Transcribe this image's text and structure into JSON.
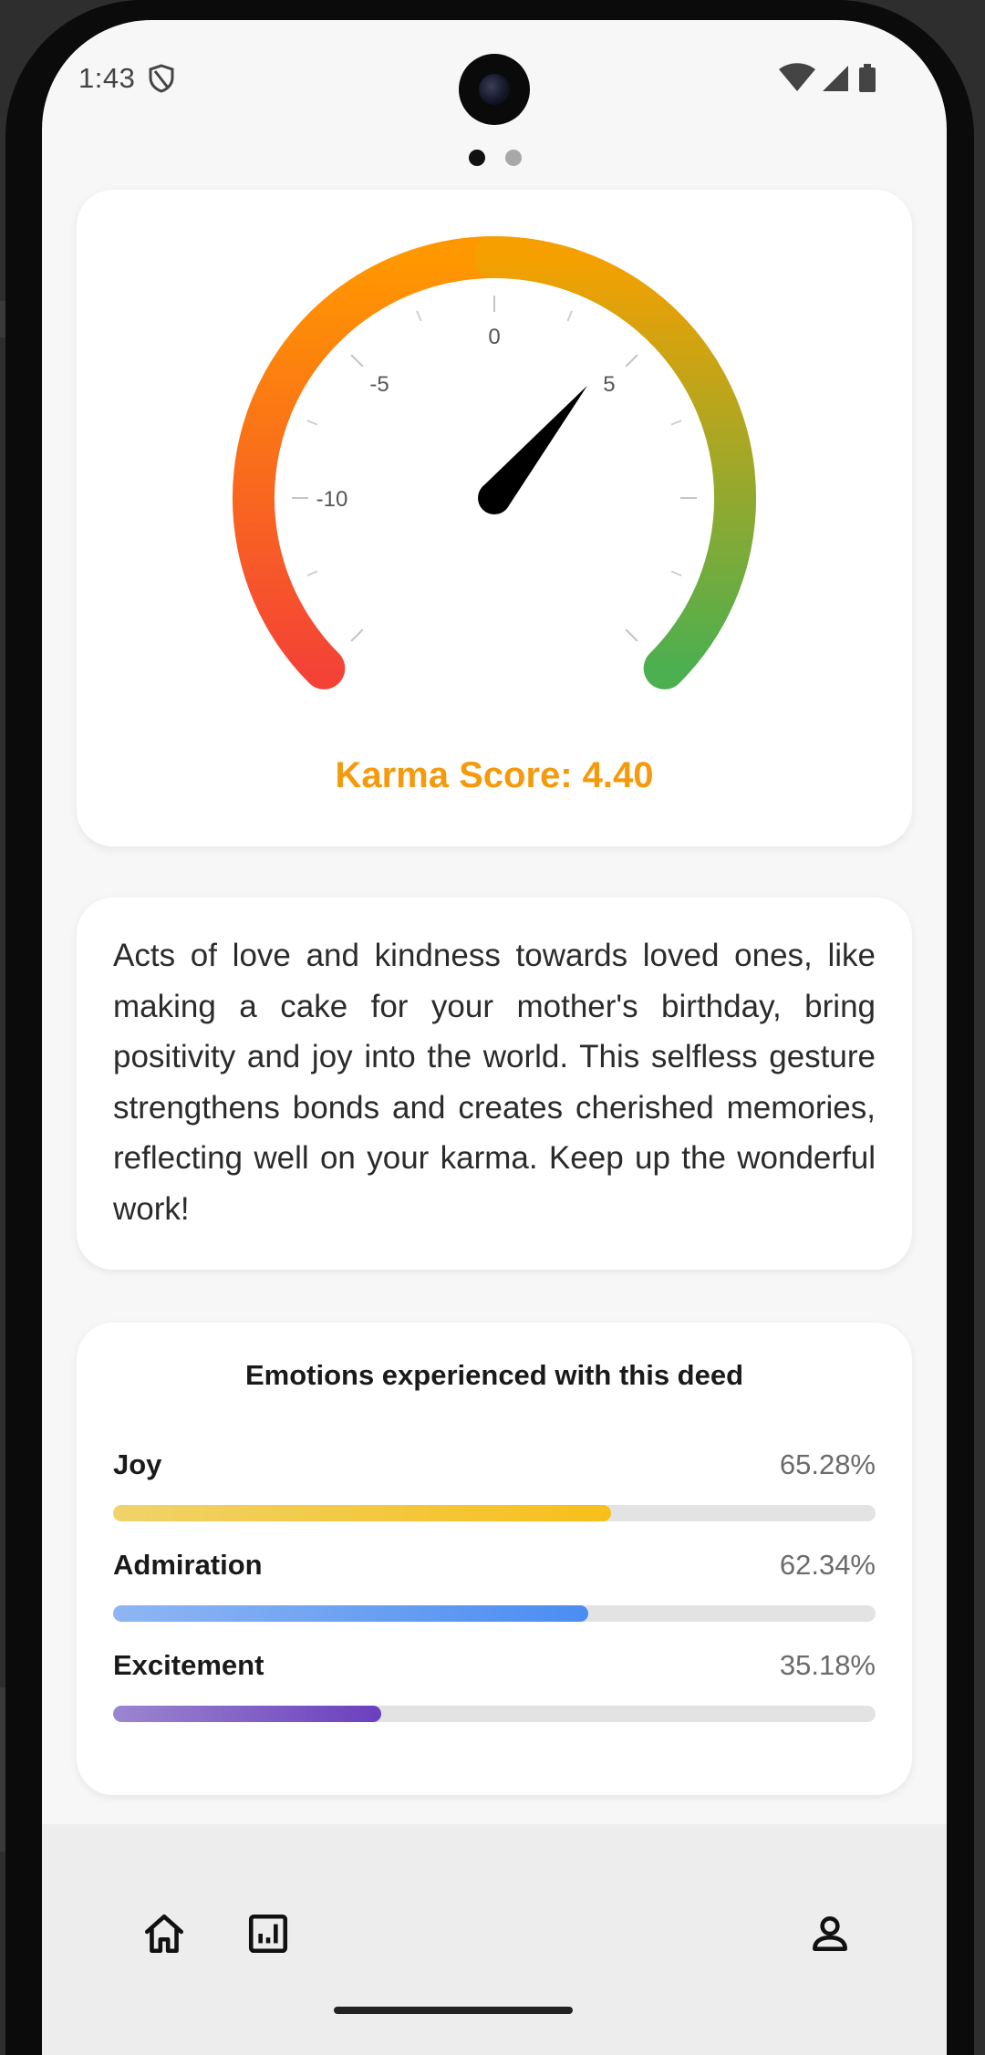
{
  "status_bar": {
    "time": "1:43"
  },
  "pager": {
    "active_index": 0,
    "count": 2
  },
  "gauge": {
    "ticks": {
      "minus10": "-10",
      "minus5": "-5",
      "zero": "0",
      "plus5": "5"
    },
    "min": -15,
    "max": 15,
    "value": 4.4,
    "colors": {
      "low": "#f44336",
      "mid": "#ff9800",
      "high": "#4caf50"
    },
    "score_label": "Karma Score: 4.40",
    "score_color": "#f59a0c"
  },
  "description": {
    "text": "Acts of love and kindness towards loved ones, like making a cake for your mother's birthday, bring positivity and joy into the world. This selfless gesture strengthens bonds and creates cherished memories, reflecting well on your karma. Keep up the wonderful work!"
  },
  "emotions": {
    "title": "Emotions experienced with this deed",
    "items": [
      {
        "name": "Joy",
        "value_label": "65.28%",
        "percent": 65.28,
        "color_start": "#f0d36a",
        "color_end": "#f7bf1a"
      },
      {
        "name": "Admiration",
        "value_label": "62.34%",
        "percent": 62.34,
        "color_start": "#8fb6f3",
        "color_end": "#4a8df2"
      },
      {
        "name": "Excitement",
        "value_label": "35.18%",
        "percent": 35.18,
        "color_start": "#9b86cf",
        "color_end": "#6b3fbf"
      }
    ]
  },
  "nav": {
    "items": [
      {
        "icon": "home-icon"
      },
      {
        "icon": "stats-icon"
      },
      {
        "icon": "profile-icon"
      }
    ]
  }
}
